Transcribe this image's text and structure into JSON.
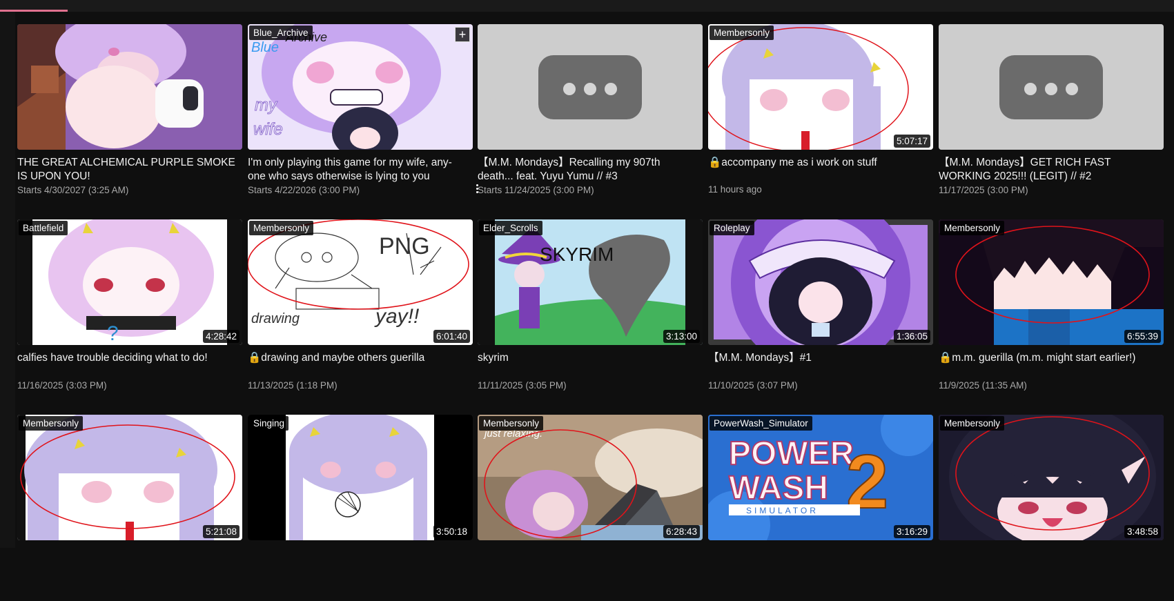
{
  "videos": [
    {
      "title": "THE GREAT ALCHEMICAL PURPLE SMOKE IS UPON YOU!",
      "meta": "Starts 4/30/2027 (3:25 AM)",
      "tag": "",
      "duration": ""
    },
    {
      "title": "I'm only playing this game for my wife, any-one who says otherwise is lying to you",
      "meta": "Starts 4/22/2026 (3:00 PM)",
      "tag": "Blue_Archive",
      "duration": ""
    },
    {
      "title": "【M.M. Mondays】Recalling my 907th death... feat. Yuyu Yumu // #3",
      "meta": "Starts 11/24/2025 (3:00 PM)",
      "tag": "",
      "duration": ""
    },
    {
      "title": "🔒accompany me as i work on stuff",
      "meta": "11 hours ago",
      "tag": "Membersonly",
      "duration": "5:07:17"
    },
    {
      "title": "【M.M. Mondays】GET RICH FAST WORKING 2025!!! (LEGIT) // #2",
      "meta": "11/17/2025 (3:00 PM)",
      "tag": "",
      "duration": ""
    },
    {
      "title": "calfies have trouble deciding what to do!",
      "meta": "11/16/2025 (3:03 PM)",
      "tag": "Battlefield",
      "duration": "4:28:42"
    },
    {
      "title": "🔒drawing and maybe others guerilla",
      "meta": "11/13/2025 (1:18 PM)",
      "tag": "Membersonly",
      "duration": "6:01:40"
    },
    {
      "title": "skyrim",
      "meta": "11/11/2025 (3:05 PM)",
      "tag": "Elder_Scrolls",
      "duration": "3:13:00"
    },
    {
      "title": "【M.M. Mondays】#1",
      "meta": "11/10/2025 (3:07 PM)",
      "tag": "Roleplay",
      "duration": "1:36:05"
    },
    {
      "title": "🔒m.m. guerilla (m.m. might start earlier!)",
      "meta": "11/9/2025 (11:35 AM)",
      "tag": "Membersonly",
      "duration": "6:55:39"
    },
    {
      "title": "",
      "meta": "",
      "tag": "Membersonly",
      "duration": "5:21:08"
    },
    {
      "title": "",
      "meta": "",
      "tag": "Singing",
      "duration": "3:50:18"
    },
    {
      "title": "",
      "meta": "",
      "tag": "Membersonly",
      "duration": "6:28:43"
    },
    {
      "title": "",
      "meta": "",
      "tag": "PowerWash_Simulator",
      "duration": "3:16:29"
    },
    {
      "title": "",
      "meta": "",
      "tag": "Membersonly",
      "duration": "3:48:58"
    }
  ],
  "thumb_text": {
    "v7_png": "PNG",
    "v7_drawing": "drawing",
    "v7_yay": "yay!!",
    "v8_skyrim": "SKYRIM",
    "v13_relaxing": "just relaxing.",
    "v14_power": "POWER",
    "v14_wash": "WASH",
    "v14_two": "2",
    "v14_sim": "SIMULATOR",
    "v2_my": "my",
    "v2_wife": "wife",
    "v2_blue": "Blue",
    "v2_archive": "Archive"
  },
  "icons": {
    "add": "plus-icon",
    "lock": "lock-icon",
    "more": "more-vert-icon",
    "placeholder": "more-horiz-icon"
  },
  "colors": {
    "accent": "#e0718f",
    "annotation": "#e0131a",
    "lavender": "#c3b8e8"
  }
}
